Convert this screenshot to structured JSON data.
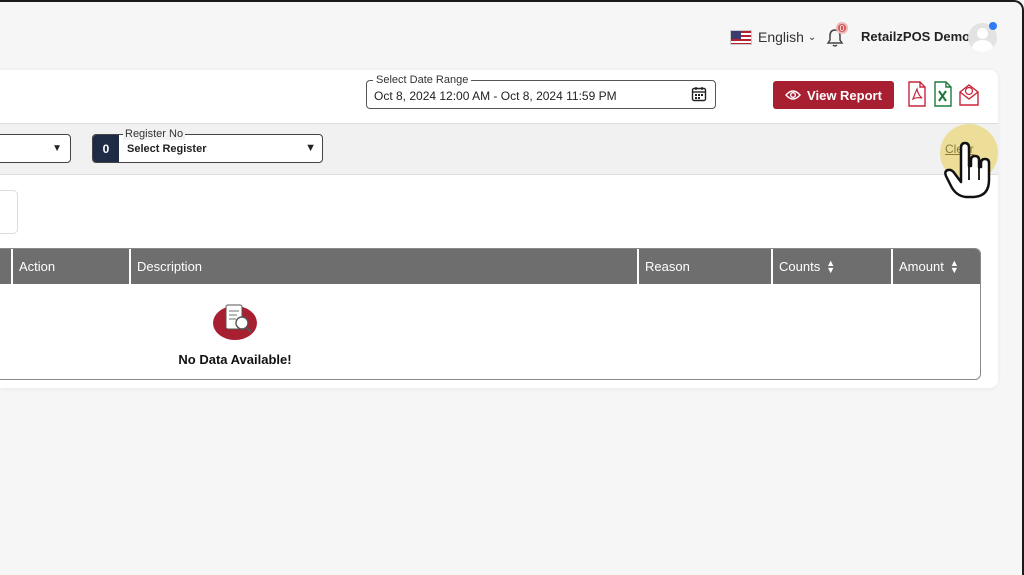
{
  "header": {
    "language": "English",
    "notification_count": "0",
    "user_name": "RetailzPOS Demo"
  },
  "filters": {
    "date_range_label": "Select Date Range",
    "date_range_value": "Oct 8, 2024 12:00 AM - Oct 8, 2024 11:59 PM",
    "view_report_label": "View Report",
    "register_label": "Register No",
    "register_badge": "0",
    "register_value": "Select Register",
    "clear_label": "Clear"
  },
  "table": {
    "columns": [
      "Action",
      "Description",
      "Reason",
      "Counts",
      "Amount"
    ],
    "empty_message": "No Data Available!"
  },
  "colors": {
    "accent": "#a91f32",
    "header_bg": "#6e6e6e",
    "badge_bg": "#1f2a44"
  }
}
